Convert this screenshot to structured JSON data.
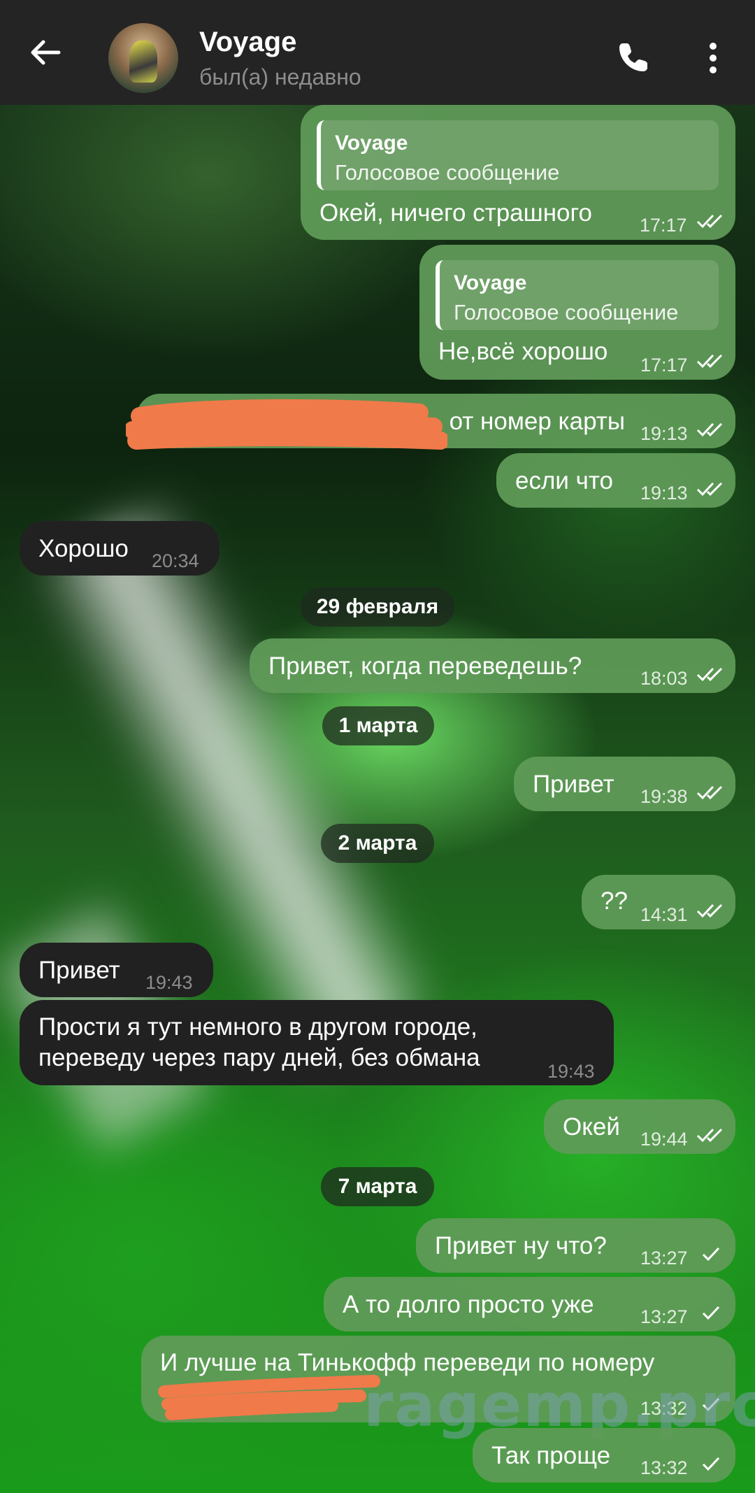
{
  "header": {
    "title": "Voyage",
    "status": "был(а) недавно"
  },
  "messages": {
    "m1": {
      "reply_name": "Voyage",
      "reply_text": "Голосовое сообщение",
      "text": "Окей, ничего страшного",
      "time": "17:17"
    },
    "m2": {
      "reply_name": "Voyage",
      "reply_text": "Голосовое сообщение",
      "text": "Не,всё хорошо",
      "time": "17:17"
    },
    "m3": {
      "text": "от номер карты",
      "time": "19:13"
    },
    "m4": {
      "text": "если что",
      "time": "19:13"
    },
    "m5": {
      "text": "Хорошо",
      "time": "20:34"
    },
    "m6": {
      "text": "Привет, когда переведешь?",
      "time": "18:03"
    },
    "m7": {
      "text": "Привет",
      "time": "19:38"
    },
    "m8": {
      "text": "??",
      "time": "14:31"
    },
    "m9": {
      "text": "Привет",
      "time": "19:43"
    },
    "m10": {
      "line1": "Прости я тут немного в другом городе,",
      "line2": "переведу через пару дней, без обмана",
      "time": "19:43"
    },
    "m11": {
      "text": "Окей",
      "time": "19:44"
    },
    "m12": {
      "text": "Привет ну что?",
      "time": "13:27"
    },
    "m13": {
      "text": "А то долго просто уже",
      "time": "13:27"
    },
    "m14": {
      "text": "И лучше на Тинькофф переведи по номеру",
      "time": "13:32"
    },
    "m15": {
      "text": "Так проще",
      "time": "13:32"
    }
  },
  "dates": {
    "d1": "29 февраля",
    "d2": "1 марта",
    "d3": "2 марта",
    "d4": "7 марта"
  },
  "watermark": "ragemp.pro",
  "colors": {
    "header_bg": "#242424",
    "outgoing_bubble": "#609b58",
    "incoming_bubble": "#212121",
    "redaction": "#f07a4a"
  },
  "icons": [
    "back-arrow-icon",
    "phone-icon",
    "more-vertical-icon",
    "double-check-icon",
    "single-check-icon"
  ]
}
